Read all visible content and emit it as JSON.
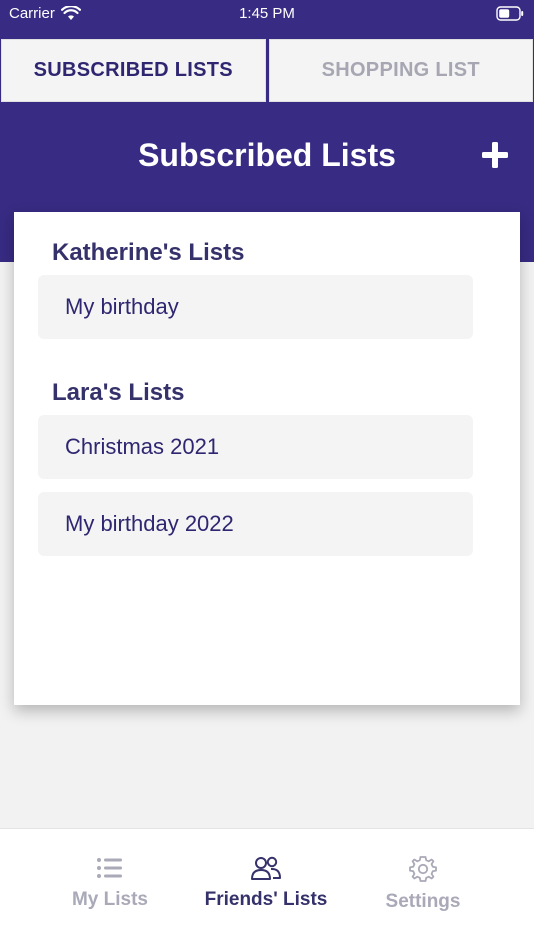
{
  "status_bar": {
    "carrier": "Carrier",
    "time": "1:45 PM"
  },
  "top_tabs": [
    {
      "label": "SUBSCRIBED LISTS",
      "active": true
    },
    {
      "label": "SHOPPING LIST",
      "active": false
    }
  ],
  "header": {
    "title": "Subscribed Lists",
    "add_icon": "plus-icon"
  },
  "groups": [
    {
      "title": "Katherine's Lists",
      "items": [
        "My birthday"
      ]
    },
    {
      "title": "Lara's Lists",
      "items": [
        "Christmas 2021",
        "My birthday 2022"
      ]
    }
  ],
  "bottom_tabs": [
    {
      "label": "My Lists",
      "icon": "list-icon",
      "active": false
    },
    {
      "label": "Friends' Lists",
      "icon": "friends-icon",
      "active": true
    },
    {
      "label": "Settings",
      "icon": "gear-icon",
      "active": false
    }
  ],
  "colors": {
    "primary": "#372b83",
    "text_dark": "#35316a",
    "inactive": "#a9a9b8"
  }
}
